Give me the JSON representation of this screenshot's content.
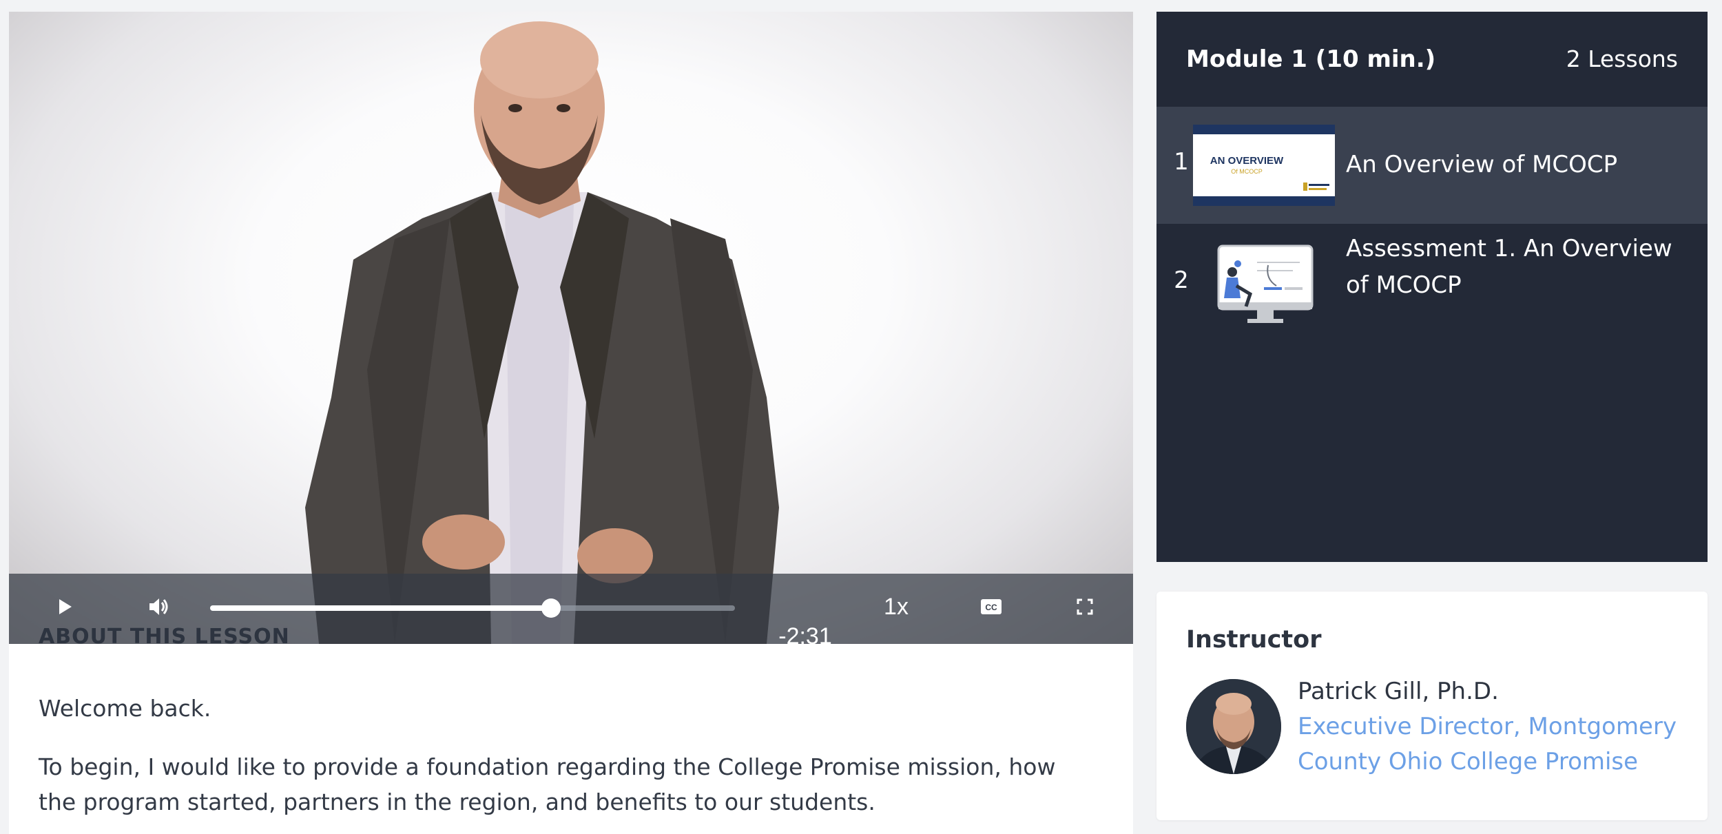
{
  "player": {
    "speed_label": "1x",
    "time_remaining": "-2:31",
    "progress": 0.65,
    "icons": {
      "play": "play-icon",
      "volume": "volume-icon",
      "captions": "closed-captions-icon",
      "fullscreen": "fullscreen-icon"
    }
  },
  "lesson": {
    "about_heading": "ABOUT THIS LESSON",
    "paragraphs": [
      "Welcome back.",
      "To begin, I would like to provide a foundation regarding the College Promise mission, how the program started, partners in the region, and benefits to our students."
    ]
  },
  "module": {
    "title": "Module 1 (10 min.)",
    "count_label": "2 Lessons",
    "lessons": [
      {
        "number": "1",
        "title": "An Overview of MCOCP",
        "thumb_title": "AN OVERVIEW",
        "thumb_subtitle": "Of MCOCP",
        "active": true
      },
      {
        "number": "2",
        "title": "Assessment 1. An Overview of MCOCP",
        "active": false
      }
    ]
  },
  "instructor": {
    "heading": "Instructor",
    "name": "Patrick Gill, Ph.D.",
    "role": "Executive Director, Montgomery County Ohio College Promise"
  },
  "colors": {
    "panel_bg": "#232937",
    "active_row_bg": "#3a4150",
    "link_blue": "#6ca0e6",
    "page_bg": "#f2f3f5"
  }
}
